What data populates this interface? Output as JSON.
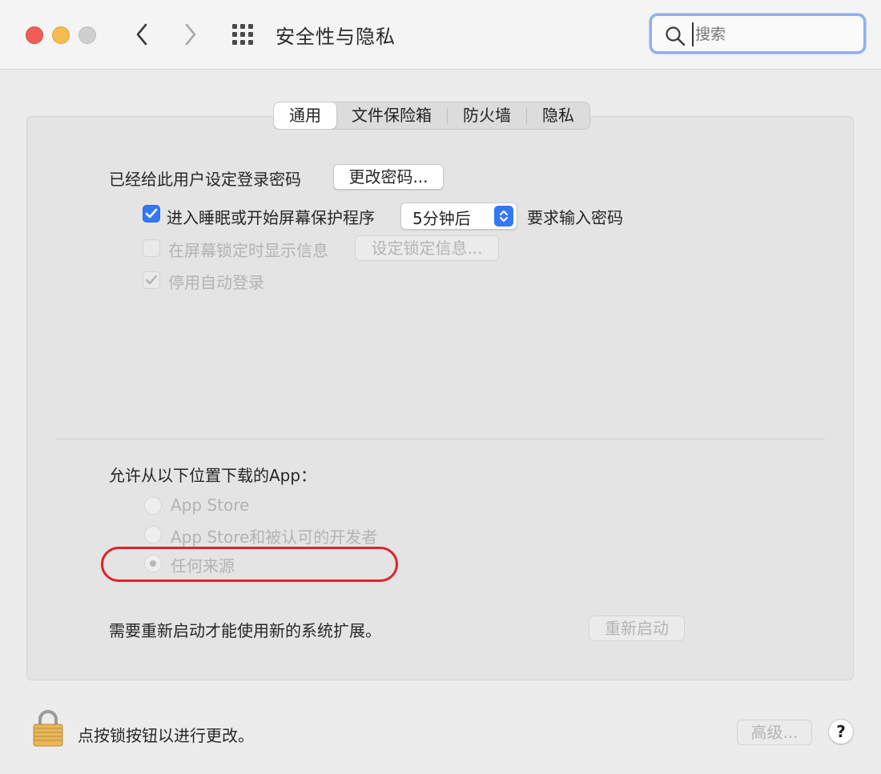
{
  "window": {
    "title": "安全性与隐私",
    "search_placeholder": "搜索"
  },
  "tabs": [
    {
      "label": "通用",
      "active": true
    },
    {
      "label": "文件保险箱",
      "active": false
    },
    {
      "label": "防火墙",
      "active": false
    },
    {
      "label": "隐私",
      "active": false
    }
  ],
  "general": {
    "password_label": "已经给此用户设定登录密码",
    "change_password_button": "更改密码...",
    "sleep_require": {
      "checked": true,
      "label": "进入睡眠或开始屏幕保护程序",
      "delay_value": "5分钟后",
      "suffix": "要求输入密码"
    },
    "lock_message": {
      "checked": false,
      "enabled": false,
      "label": "在屏幕锁定时显示信息",
      "button": "设定锁定信息..."
    },
    "disable_autologin": {
      "checked": true,
      "enabled": false,
      "label": "停用自动登录"
    }
  },
  "downloads": {
    "heading": "允许从以下位置下载的App：",
    "options": [
      {
        "label": "App Store",
        "selected": false
      },
      {
        "label": "App Store和被认可的开发者",
        "selected": false
      },
      {
        "label": "任何来源",
        "selected": true
      }
    ]
  },
  "extensions": {
    "message": "需要重新启动才能使用新的系统扩展。",
    "restart_button": "重新启动"
  },
  "footer": {
    "lock_text": "点按锁按钮以进行更改。",
    "advanced_button": "高级...",
    "help_button": "?"
  },
  "colors": {
    "accent": "#3478f6",
    "highlight": "#e2222a"
  }
}
